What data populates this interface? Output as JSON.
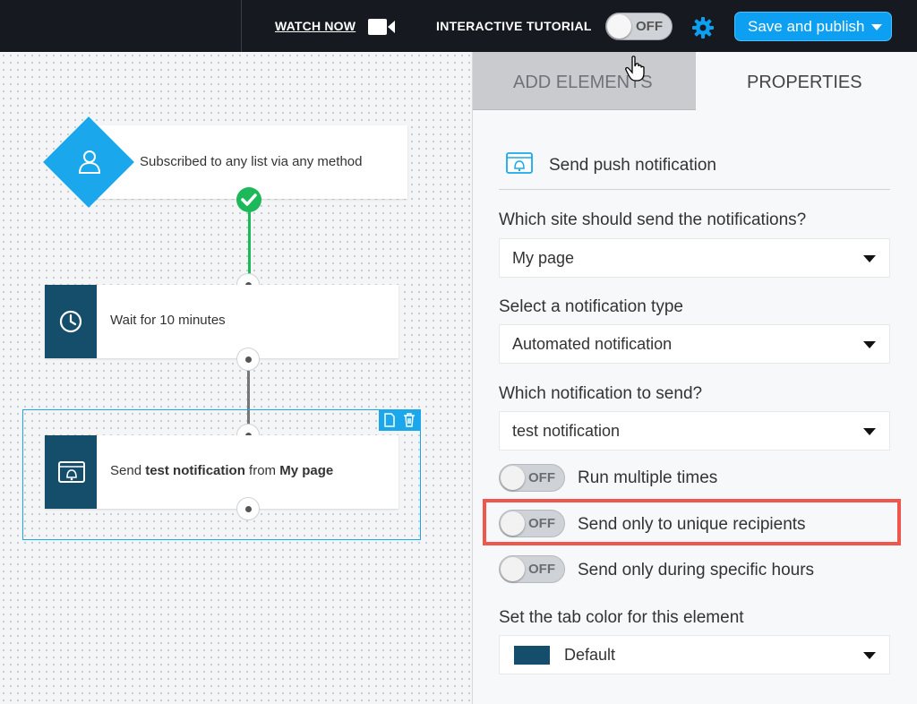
{
  "topbar": {
    "watch_label": "WATCH NOW",
    "tutorial_label": "INTERACTIVE TUTORIAL",
    "tutorial_toggle": "OFF",
    "publish_label": "Save and publish"
  },
  "flow": {
    "trigger_label": "Subscribed to any list via any method",
    "wait_label": "Wait for 10 minutes",
    "send_prefix": "Send ",
    "send_notification": "test notification",
    "send_mid": " from ",
    "send_site": "My page"
  },
  "panel": {
    "tabs": {
      "add": "ADD ELEMENTS",
      "properties": "PROPERTIES"
    },
    "title": "Send push notification",
    "site_label": "Which site should send the notifications?",
    "site_value": "My page",
    "type_label": "Select a notification type",
    "type_value": "Automated notification",
    "notif_label": "Which notification to send?",
    "notif_value": "test notification",
    "toggles": [
      {
        "state": "OFF",
        "label": "Run multiple times"
      },
      {
        "state": "OFF",
        "label": "Send only to unique recipients"
      },
      {
        "state": "OFF",
        "label": "Send only during specific hours"
      }
    ],
    "color_label": "Set the tab color for this element",
    "color_value": "Default"
  },
  "colors": {
    "accent": "#1aa7ec",
    "tab": "#154e6a",
    "success": "#1cb85a",
    "highlight": "#f0574c"
  }
}
